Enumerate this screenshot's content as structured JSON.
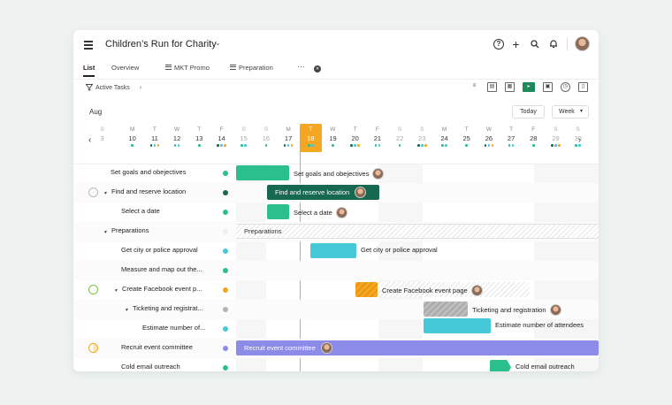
{
  "app": {
    "project_title": "Children’s Run for Charity"
  },
  "tabs": [
    {
      "label": "List",
      "active": true
    },
    {
      "label": "Overview",
      "active": false
    },
    {
      "label": "MKT Promo",
      "active": false
    },
    {
      "label": "Preparation",
      "active": false
    }
  ],
  "toolbar": {
    "filter_label": "Active Tasks"
  },
  "calendar": {
    "month": "Aug",
    "today_label": "Today",
    "view_label": "Week",
    "days": [
      {
        "l": "S",
        "n": "3"
      },
      {
        "l": "M",
        "n": "10"
      },
      {
        "l": "T",
        "n": "11"
      },
      {
        "l": "W",
        "n": "12"
      },
      {
        "l": "T",
        "n": "13"
      },
      {
        "l": "F",
        "n": "14"
      },
      {
        "l": "S",
        "n": "15"
      },
      {
        "l": "S",
        "n": "16"
      },
      {
        "l": "M",
        "n": "17"
      },
      {
        "l": "T",
        "n": "18"
      },
      {
        "l": "W",
        "n": "19"
      },
      {
        "l": "T",
        "n": "20"
      },
      {
        "l": "F",
        "n": "21"
      },
      {
        "l": "S",
        "n": "22"
      },
      {
        "l": "S",
        "n": "23"
      },
      {
        "l": "M",
        "n": "24"
      },
      {
        "l": "T",
        "n": "25"
      },
      {
        "l": "W",
        "n": "26"
      },
      {
        "l": "T",
        "n": "27"
      },
      {
        "l": "F",
        "n": "28"
      },
      {
        "l": "S",
        "n": "29"
      },
      {
        "l": "S",
        "n": "30"
      }
    ]
  },
  "tasks": [
    {
      "name": "Set goals and obejectives",
      "bar_label": "Set goals and obejectives"
    },
    {
      "name": "Find and reserve location",
      "bar_label": "Find and reserve location"
    },
    {
      "name": "Select a date",
      "bar_label": "Select a date"
    },
    {
      "name": "Preparations",
      "bar_label": "Preparations"
    },
    {
      "name": "Get city or police approval",
      "bar_label": "Get city or police approval"
    },
    {
      "name": "Measure and map out the...",
      "bar_label": ""
    },
    {
      "name": "Create Facebook event p...",
      "bar_label": "Create Facebook event page"
    },
    {
      "name": "Ticketing and registrat...",
      "bar_label": "Ticketing and registration"
    },
    {
      "name": "Estimate number of...",
      "bar_label": "Estimate number of attendees"
    },
    {
      "name": "Recruit event committee",
      "bar_label": "Recruit event committee"
    },
    {
      "name": "Cold email outreach",
      "bar_label": "Cold email outreach"
    }
  ],
  "colors": {
    "today": "#f5a623",
    "teal": "#2bbf8e",
    "darkgreen": "#16684f",
    "cyan": "#45c8d8",
    "purple": "#8c8ce8",
    "orange": "#f5a623",
    "gray": "#b5b5b5"
  }
}
